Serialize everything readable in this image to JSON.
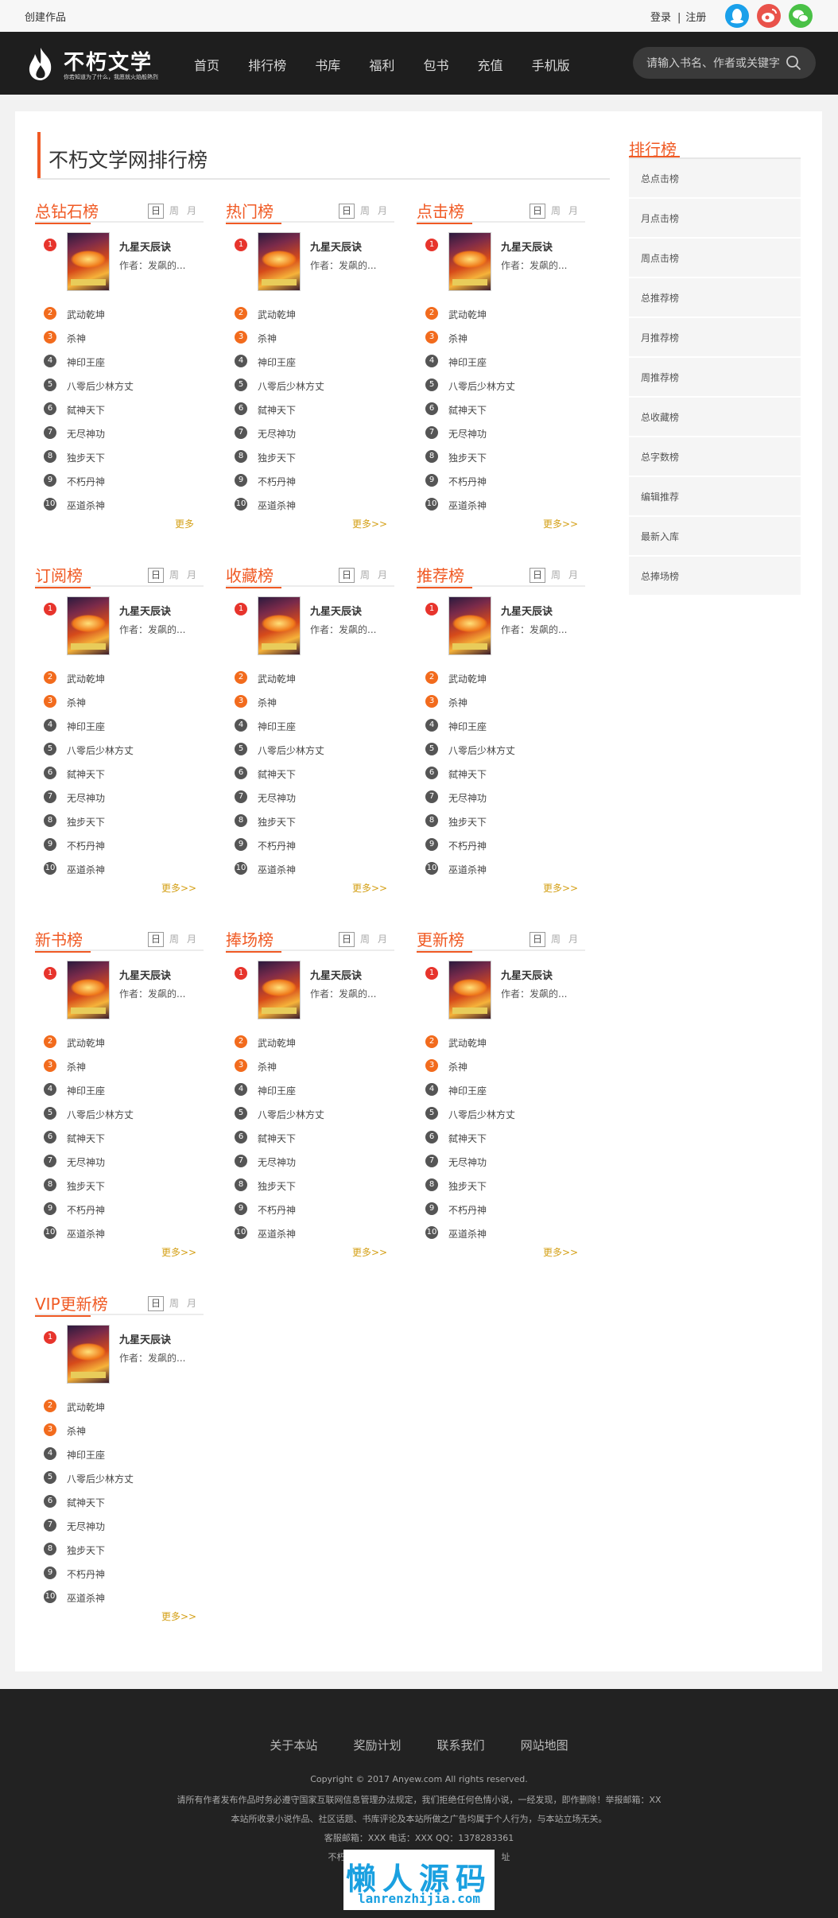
{
  "topbar": {
    "create": "创建作品",
    "login": "登录",
    "sep": "|",
    "register": "注册"
  },
  "colors": {
    "accent": "#f05a24",
    "qq": "#1aa0ea",
    "weibo": "#e9524a",
    "wechat": "#49c146",
    "more": "#d4a017"
  },
  "logo": {
    "name": "不朽文学",
    "slogan": "你若知道为了什么，我愿就火焰般熱烈"
  },
  "nav": [
    "首页",
    "排行榜",
    "书库",
    "福利",
    "包书",
    "充值",
    "手机版"
  ],
  "search": {
    "placeholder": "请输入书名、作者或关键字"
  },
  "page_title": "不朽文学网排行榜",
  "tabs": [
    "日",
    "周",
    "月"
  ],
  "blocks": [
    {
      "title": "总钻石榜",
      "more": "更多"
    },
    {
      "title": "热门榜",
      "more": "更多>>"
    },
    {
      "title": "点击榜",
      "more": "更多>>"
    },
    {
      "title": "订阅榜",
      "more": "更多>>"
    },
    {
      "title": "收藏榜",
      "more": "更多>>"
    },
    {
      "title": "推荐榜",
      "more": "更多>>"
    },
    {
      "title": "新书榜",
      "more": "更多>>"
    },
    {
      "title": "捧场榜",
      "more": "更多>>"
    },
    {
      "title": "更新榜",
      "more": "更多>>"
    },
    {
      "title": "VIP更新榜",
      "more": "更多>>"
    }
  ],
  "top_book": {
    "title": "九星天辰诀",
    "author": "作者：发飙的..."
  },
  "ranks": [
    "1",
    "2",
    "3",
    "4",
    "5",
    "6",
    "7",
    "8",
    "9",
    "10"
  ],
  "list": [
    "武动乾坤",
    "杀神",
    "神印王座",
    "八零后少林方丈",
    "弑神天下",
    "无尽神功",
    "独步天下",
    "不朽丹神",
    "巫道杀神"
  ],
  "sidebar": {
    "title": "排行榜",
    "items": [
      "总点击榜",
      "月点击榜",
      "周点击榜",
      "总推荐榜",
      "月推荐榜",
      "周推荐榜",
      "总收藏榜",
      "总字数榜",
      "编辑推荐",
      "最新入库",
      "总捧场榜"
    ]
  },
  "footer": {
    "links": [
      "关于本站",
      "奖励计划",
      "联系我们",
      "网站地图"
    ],
    "copyright": "Copyright © 2017 Anyew.com All rights reserved.",
    "notice": "请所有作者发布作品时务必遵守国家互联网信息管理办法规定，我们拒绝任何色情小说，一经发现，即作删除！举报邮箱：XX",
    "disclaimer": "本站所收录小说作品、社区话题、书库评论及本站所做之广告均属于个人行为，与本站立场无关。",
    "contact": "客服邮箱：XXX 电话：XXX QQ：1378283361",
    "domain_partial_left": "不朽",
    "domain_partial_right": "址"
  },
  "watermark": {
    "big": "懒人源码",
    "small": "lanrenzhijia.com"
  }
}
